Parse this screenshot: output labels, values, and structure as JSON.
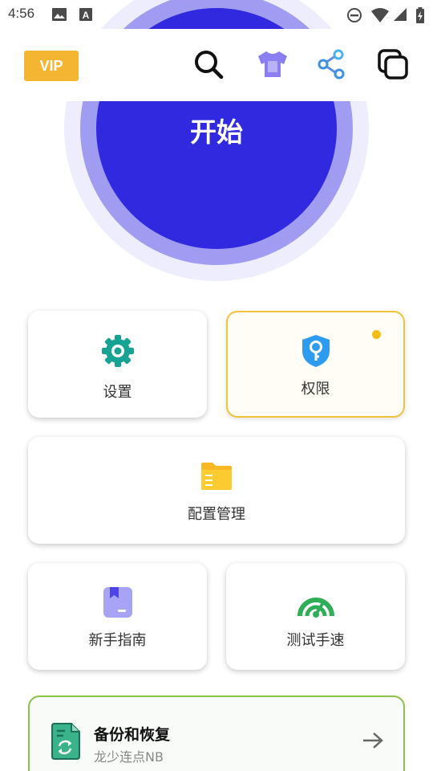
{
  "status_bar": {
    "time": "4:56",
    "left_icons": [
      "image-icon",
      "a-icon"
    ],
    "right_icons": [
      "dnd-icon",
      "wifi-icon",
      "signal-icon",
      "battery-icon"
    ]
  },
  "toolbar": {
    "vip_label": "VIP",
    "icons": [
      "search-icon",
      "shirt-icon",
      "share-icon",
      "copy-icon"
    ],
    "vip_color": "#f3b532"
  },
  "start_button": {
    "label": "开始",
    "color": "#3029e0"
  },
  "grid": {
    "settings_label": "设置",
    "permissions_label": "权限",
    "config_label": "配置管理",
    "guide_label": "新手指南",
    "speed_label": "测试手速"
  },
  "backup": {
    "title": "备份和恢复",
    "subtitle": "龙少连点NB"
  },
  "colors": {
    "accent": "#3029e0",
    "permission_border": "#f4c23b",
    "backup_border": "#8bc34a"
  }
}
